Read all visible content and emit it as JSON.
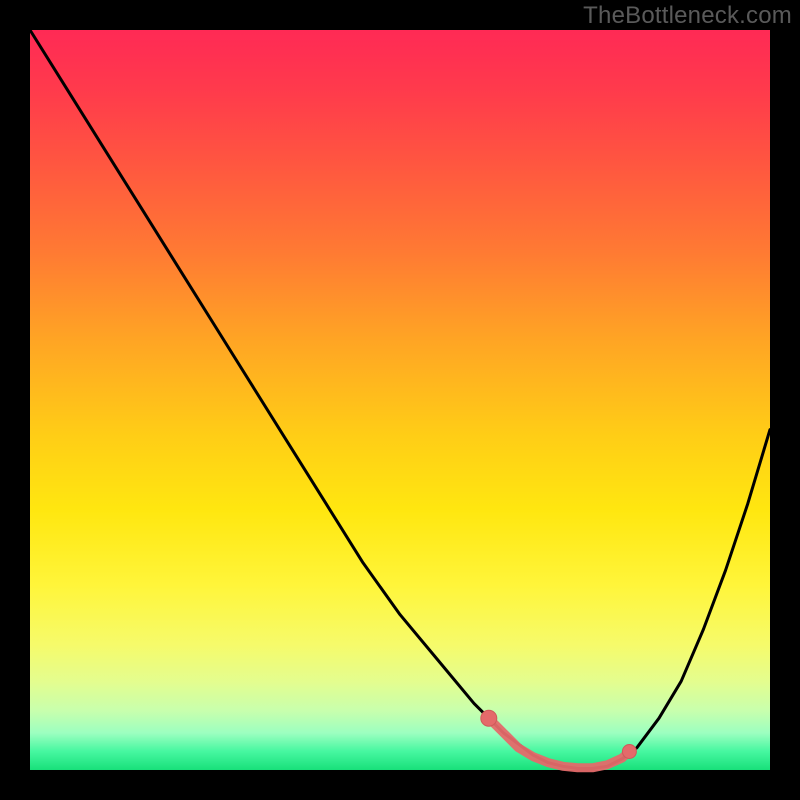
{
  "watermark": "TheBottleneck.com",
  "colors": {
    "frame": "#000000",
    "curve": "#000000",
    "marker_fill": "#e46a6a",
    "marker_stroke": "#cf5a5a",
    "gradient_top": "#ff2a55",
    "gradient_bottom": "#18e07a"
  },
  "chart_data": {
    "type": "line",
    "title": "",
    "xlabel": "",
    "ylabel": "",
    "xlim": [
      0,
      100
    ],
    "ylim": [
      0,
      100
    ],
    "x": [
      0,
      5,
      10,
      15,
      20,
      25,
      30,
      35,
      40,
      45,
      50,
      55,
      60,
      62,
      64,
      66,
      68,
      70,
      72,
      74,
      76,
      78,
      80,
      82,
      85,
      88,
      91,
      94,
      97,
      100
    ],
    "values": [
      100,
      92,
      84,
      76,
      68,
      60,
      52,
      44,
      36,
      28,
      21,
      15,
      9,
      7,
      5,
      3.5,
      2,
      1,
      0.5,
      0.2,
      0.2,
      0.5,
      1.5,
      3,
      7,
      12,
      19,
      27,
      36,
      46
    ],
    "markers": {
      "segment_start": {
        "x": 62,
        "y": 7
      },
      "segment_end": {
        "x": 81,
        "y": 2.5
      },
      "bottom_path_x": [
        62,
        64,
        66,
        68,
        70,
        72,
        74,
        76,
        78,
        80,
        81
      ],
      "bottom_path_y": [
        7,
        5,
        3,
        1.8,
        1,
        0.5,
        0.3,
        0.3,
        0.7,
        1.6,
        2.5
      ]
    }
  }
}
